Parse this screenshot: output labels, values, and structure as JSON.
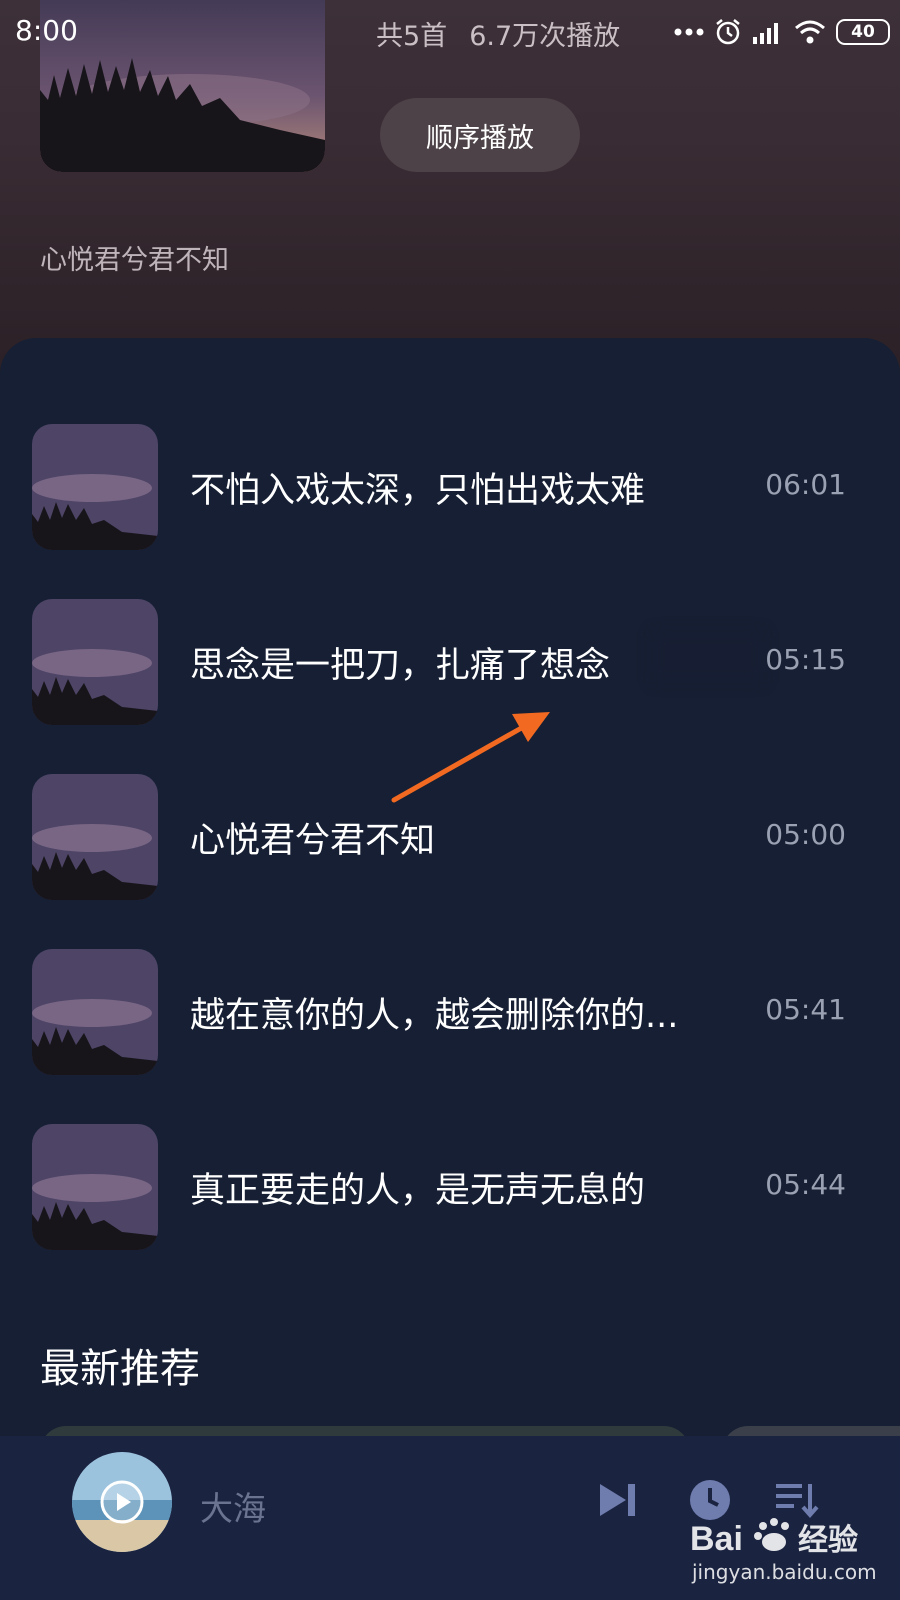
{
  "status_bar": {
    "time": "8:00",
    "battery": "40"
  },
  "hero": {
    "count": "共5首",
    "plays": "6.7万次播放",
    "play_order_label": "顺序播放",
    "description": "心悦君兮君不知"
  },
  "songs": [
    {
      "title": "不怕入戏太深，只怕出戏太难",
      "duration": "06:01"
    },
    {
      "title": "思念是一把刀，扎痛了想念",
      "duration": "05:15"
    },
    {
      "title": "心悦君兮君不知",
      "duration": "05:00"
    },
    {
      "title": "越在意你的人，越会删除你的...",
      "duration": "05:41"
    },
    {
      "title": "真正要走的人，是无声无息的",
      "duration": "05:44"
    }
  ],
  "section": {
    "title": "最新推荐"
  },
  "mini_player": {
    "title": "大海"
  },
  "watermark": {
    "brand": "Bai 经验",
    "url": "jingyan.baidu.com"
  },
  "colors": {
    "panel": "#161f33",
    "hero": "#3a2c34",
    "arrow": "#f26a21",
    "mini_player": "#1a2340"
  }
}
